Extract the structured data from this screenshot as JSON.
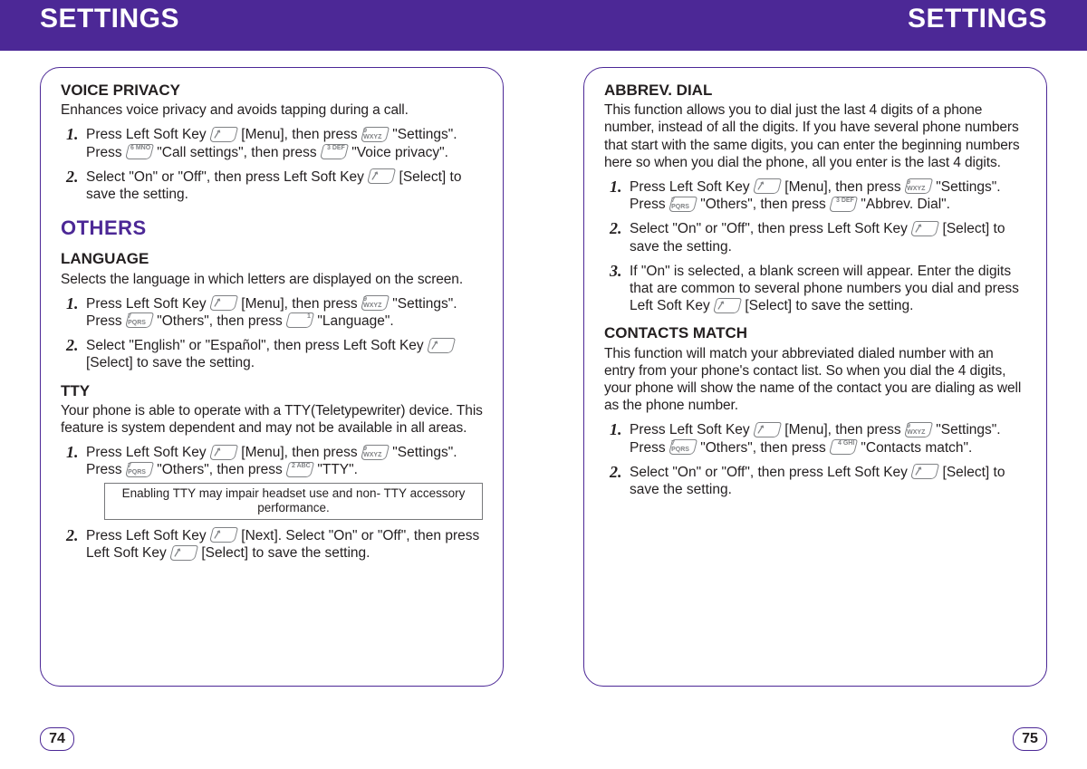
{
  "header": {
    "title_left": "SETTINGS",
    "title_right": "SETTINGS"
  },
  "page_numbers": {
    "left": "74",
    "right": "75"
  },
  "keys": {
    "softkey": "",
    "k1": "1",
    "k2": "2 ABC",
    "k3": "3 DEF",
    "k4": "4 GHI",
    "k6": "6 MNO",
    "k7": "7 PQRS",
    "k9": "9 WXYZ"
  },
  "left_page": {
    "voice_privacy": {
      "title": "VOICE PRIVACY",
      "desc": "Enhances voice privacy and avoids tapping during a call.",
      "step1a": "Press Left Soft Key ",
      "step1b": " [Menu], then press ",
      "step1c": " \"Settings\".",
      "step1d": "Press ",
      "step1e": " \"Call settings\", then press ",
      "step1f": " \"Voice privacy\".",
      "step2a": "Select \"On\" or \"Off\", then press Left Soft Key ",
      "step2b": " [Select] to save the setting."
    },
    "others_title": "OTHERS",
    "language": {
      "title": "LANGUAGE",
      "desc": "Selects the language in which letters are displayed on the screen.",
      "step1a": "Press Left Soft Key ",
      "step1b": " [Menu], then press ",
      "step1c": " \"Settings\".",
      "step1d": "Press ",
      "step1e": " \"Others\", then press ",
      "step1f": " \"Language\".",
      "step2a": "Select \"English\" or \"Español\", then press Left Soft Key ",
      "step2b": " [Select] to save the setting."
    },
    "tty": {
      "title": "TTY",
      "desc": "Your phone is able to operate with a TTY(Teletypewriter) device. This feature is system dependent and may not be available in all areas.",
      "step1a": "Press Left Soft Key ",
      "step1b": " [Menu], then press ",
      "step1c": " \"Settings\".",
      "step1d": "Press ",
      "step1e": " \"Others\", then press ",
      "step1f": " \"TTY\".",
      "note": "Enabling TTY may impair headset use and non- TTY accessory performance.",
      "step2a": "Press Left Soft Key ",
      "step2b": " [Next]. Select \"On\" or \"Off\", then press Left Soft Key ",
      "step2c": " [Select] to save the setting."
    }
  },
  "right_page": {
    "abbrev": {
      "title": "ABBREV. DIAL",
      "desc": "This function allows you to dial just the last 4 digits of a phone number, instead of all the digits. If you have several phone numbers that start with the same digits, you can enter the beginning numbers here so when you dial the phone, all you enter is the last 4 digits.",
      "step1a": "Press Left Soft Key ",
      "step1b": " [Menu], then press ",
      "step1c": " \"Settings\".",
      "step1d": "Press ",
      "step1e": " \"Others\", then press ",
      "step1f": " \"Abbrev. Dial\".",
      "step2a": "Select \"On\" or \"Off\", then press Left Soft Key ",
      "step2b": " [Select] to save the setting.",
      "step3a": "If \"On\" is selected, a blank screen will appear. Enter the digits that are common to several phone numbers you dial and press Left Soft Key ",
      "step3b": " [Select] to save the setting."
    },
    "contacts": {
      "title": "CONTACTS MATCH",
      "desc": "This function will match your abbreviated dialed number with an entry from your phone's contact list. So when you dial the 4 digits, your phone will show the name of the contact you are dialing as well as the phone number.",
      "step1a": "Press Left Soft Key ",
      "step1b": " [Menu], then press ",
      "step1c": " \"Settings\".",
      "step1d": "Press ",
      "step1e": " \"Others\", then press ",
      "step1f": " \"Contacts match\".",
      "step2a": "Select \"On\" or \"Off\", then press Left Soft Key ",
      "step2b": " [Select] to save the setting."
    }
  }
}
